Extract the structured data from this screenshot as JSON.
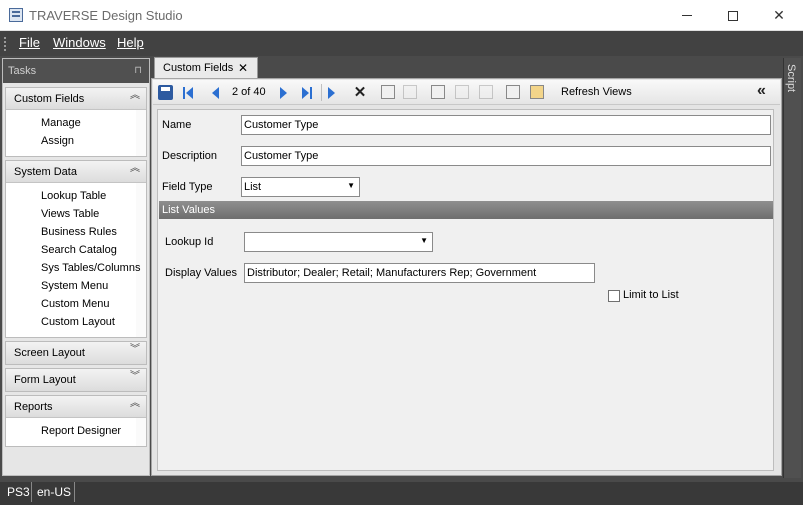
{
  "window": {
    "title": "TRAVERSE Design Studio",
    "minimize_label": "",
    "close_glyph": "✕"
  },
  "menu": {
    "file": "File",
    "windows": "Windows",
    "help": "Help"
  },
  "tasks": {
    "title": "Tasks",
    "pin_glyph": "⊓",
    "groups": [
      {
        "title": "Custom Fields",
        "expanded": true,
        "items": [
          "Manage",
          "Assign"
        ]
      },
      {
        "title": "System Data",
        "expanded": true,
        "items": [
          "Lookup Table",
          "Views Table",
          "Business Rules",
          "Search Catalog",
          "Sys Tables/Columns",
          "System Menu",
          "Custom Menu",
          "Custom Layout"
        ]
      },
      {
        "title": "Screen Layout",
        "expanded": false,
        "items": []
      },
      {
        "title": "Form Layout",
        "expanded": false,
        "items": []
      },
      {
        "title": "Reports",
        "expanded": true,
        "items": [
          "Report Designer"
        ]
      }
    ],
    "chev_up": "︽",
    "chev_down": "︾"
  },
  "document": {
    "tab_label": "Custom Fields",
    "tab_close": "✕",
    "toolbar": {
      "page_info": "2 of 40",
      "refresh_views": "Refresh Views",
      "delete_glyph": "✕",
      "collapse_glyph": "«"
    },
    "form": {
      "name_label": "Name",
      "name_value": "Customer Type",
      "description_label": "Description",
      "description_value": "Customer Type",
      "field_type_label": "Field Type",
      "field_type_value": "List",
      "list_values_header": "List Values",
      "lookup_id_label": "Lookup Id",
      "lookup_id_value": "",
      "display_values_label": "Display Values",
      "display_values_value": "Distributor; Dealer; Retail; Manufacturers Rep; Government",
      "limit_to_list_label": "Limit to List",
      "limit_to_list_checked": false,
      "dropdown_arrow": "▼"
    }
  },
  "side_panel": {
    "script_label": "Script"
  },
  "status": {
    "item1": "PS3",
    "item2": "en-US"
  }
}
